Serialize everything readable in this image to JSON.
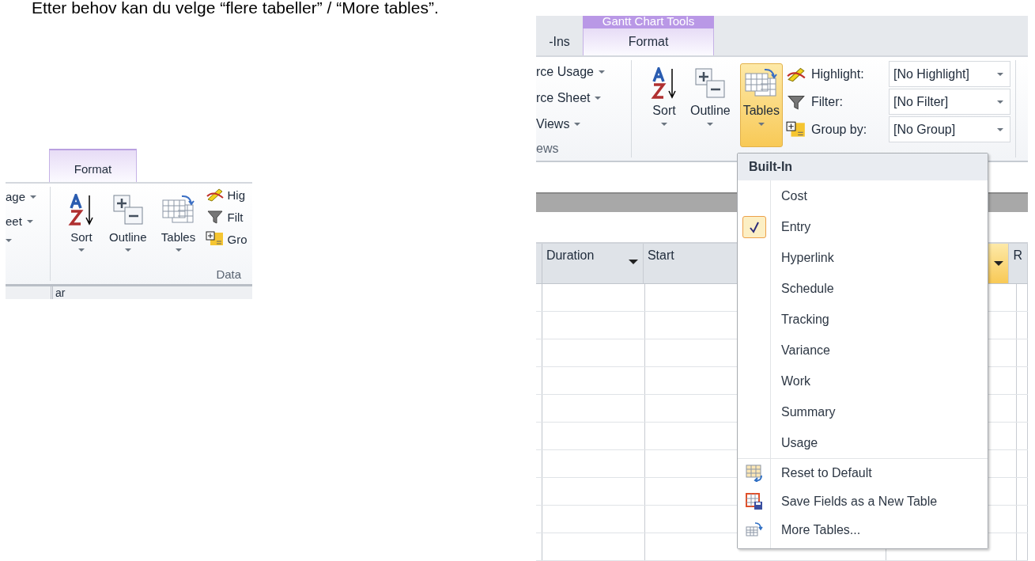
{
  "instruction_text": "Etter behov kan du velge “flere tabeller” / “More tables”.",
  "left_screenshot": {
    "tabs": [
      {
        "label": "Format",
        "selected": true
      }
    ],
    "view_items": [
      "age",
      "eet"
    ],
    "buttons": [
      {
        "label": "Sort",
        "kind": "sort",
        "selected": false
      },
      {
        "label": "Outline",
        "kind": "outline",
        "selected": false
      },
      {
        "label": "Tables",
        "kind": "tables",
        "selected": false
      }
    ],
    "data_rows": [
      {
        "label": "Hig",
        "kind": "highlight"
      },
      {
        "label": "Filt",
        "kind": "filter"
      },
      {
        "label": "Gro",
        "kind": "group"
      }
    ],
    "group_label": "Data",
    "strip_text": "ar"
  },
  "right_screenshot": {
    "context_group": "Gantt Chart Tools",
    "tabs": [
      {
        "label": "-Ins",
        "selected": false
      },
      {
        "label": "Format",
        "selected": true
      }
    ],
    "view_items": [
      "rce Usage",
      "rce Sheet",
      "Views"
    ],
    "views_group_label": "ews",
    "buttons": [
      {
        "label": "Sort",
        "kind": "sort",
        "selected": false
      },
      {
        "label": "Outline",
        "kind": "outline",
        "selected": false
      },
      {
        "label": "Tables",
        "kind": "tables",
        "selected": true
      }
    ],
    "data_rows": [
      {
        "label": "Highlight:",
        "kind": "highlight",
        "value": "[No Highlight]"
      },
      {
        "label": "Filter:",
        "kind": "filter",
        "value": "[No Filter]"
      },
      {
        "label": "Group by:",
        "kind": "group",
        "value": "[No Group]"
      }
    ],
    "columns": [
      {
        "label": "Duration",
        "dropdown": true,
        "selected": false
      },
      {
        "label": "Start",
        "dropdown": false,
        "selected": false
      },
      {
        "dropdown": true,
        "selected": true
      },
      {
        "label": "R",
        "dropdown": false,
        "selected": false
      }
    ],
    "menu": {
      "header": "Built-In",
      "items": [
        {
          "label": "Cost",
          "checked": false
        },
        {
          "label": "Entry",
          "checked": true
        },
        {
          "label": "Hyperlink",
          "checked": false
        },
        {
          "label": "Schedule",
          "checked": false
        },
        {
          "label": "Tracking",
          "checked": false
        },
        {
          "label": "Variance",
          "checked": false
        },
        {
          "label": "Work",
          "checked": false
        },
        {
          "label": "Summary",
          "checked": false
        },
        {
          "label": "Usage",
          "checked": false
        }
      ],
      "actions": [
        {
          "label": "Reset to Default",
          "kind": "reset"
        },
        {
          "label": "Save Fields as a New Table",
          "kind": "save"
        },
        {
          "label": "More Tables...",
          "kind": "more"
        }
      ]
    }
  }
}
